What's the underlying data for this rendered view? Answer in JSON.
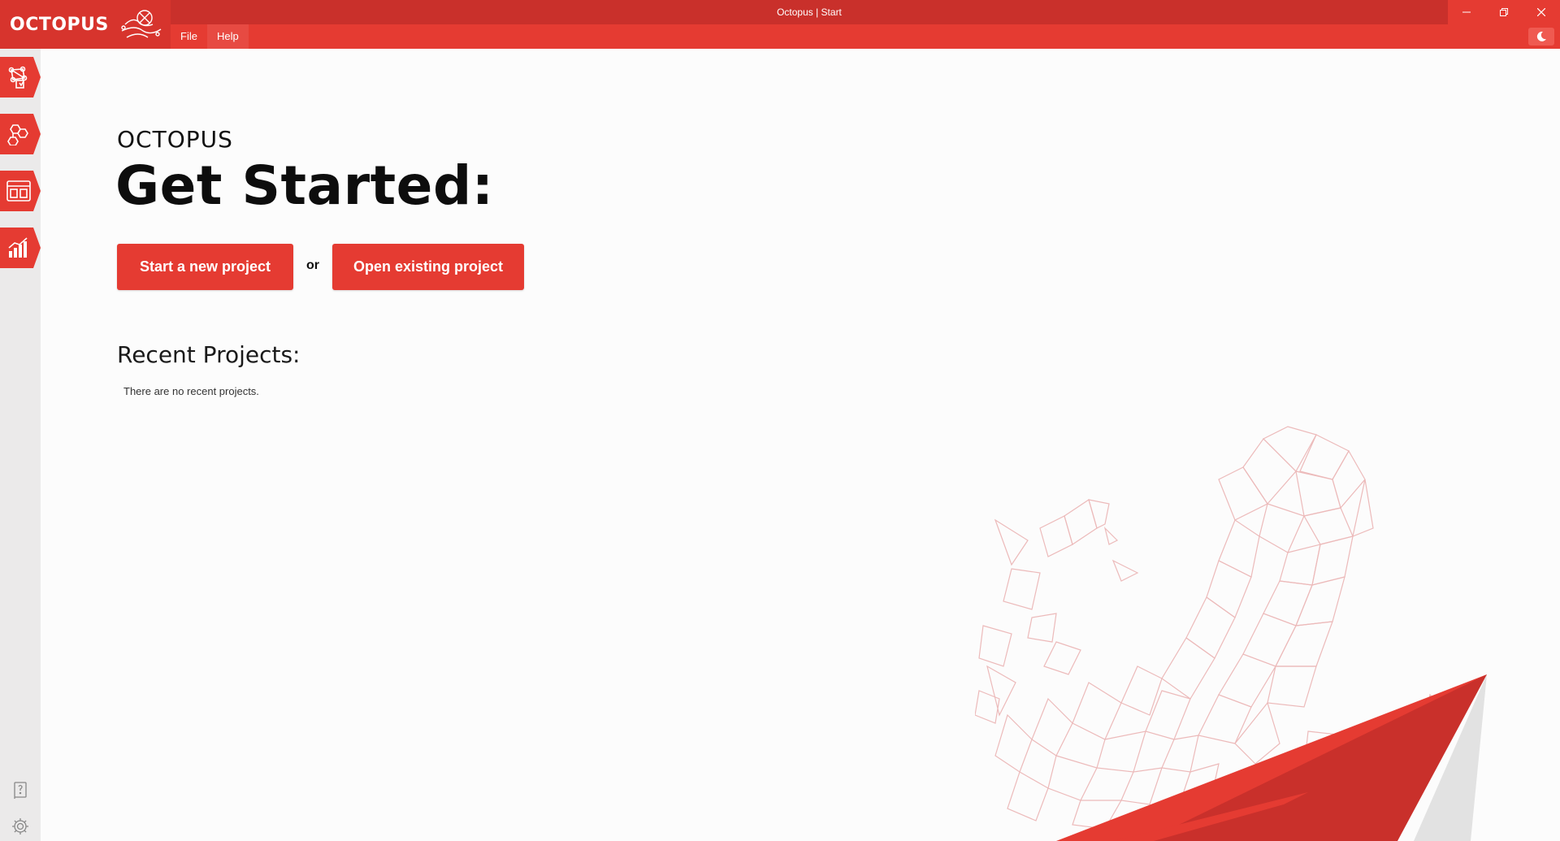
{
  "window": {
    "title": "Octopus | Start"
  },
  "logo": {
    "text": "OCTOPUS"
  },
  "menu": {
    "items": [
      "File",
      "Help"
    ]
  },
  "sidebar": {
    "tabs": [
      {
        "icon": "network-structure-icon"
      },
      {
        "icon": "molecule-icon"
      },
      {
        "icon": "dashboard-layout-icon"
      },
      {
        "icon": "bar-chart-icon"
      }
    ],
    "bottom": [
      {
        "icon": "help-book-icon"
      },
      {
        "icon": "gear-icon"
      }
    ]
  },
  "start": {
    "brand": "OCTOPUS",
    "headline": "Get Started:",
    "new_project_label": "Start a new project",
    "or_label": "or",
    "open_project_label": "Open existing project",
    "recent_title": "Recent Projects:",
    "recent_empty": "There are no recent projects."
  },
  "colors": {
    "accent": "#e53b32",
    "titlebar_dark": "#c9302b",
    "sidebar": "#ebeaea",
    "background": "#fcfcfc"
  }
}
